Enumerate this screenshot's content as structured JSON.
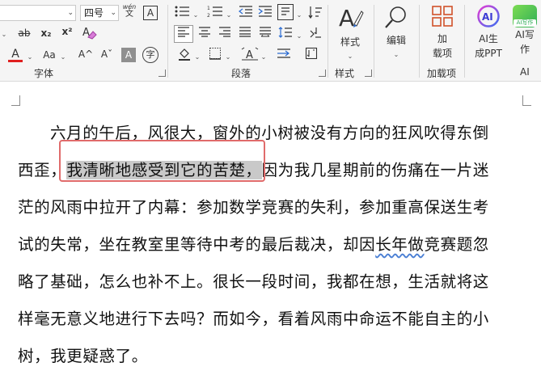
{
  "ribbon": {
    "font": {
      "size_value": "四号",
      "phonetic_top": "wén",
      "phonetic_bottom": "文",
      "box_char": "A",
      "strike": "ab",
      "sub": "x₂",
      "sup": "x²",
      "font_color_letter": "A",
      "change_case": "Aa",
      "grow": "A^",
      "shrink": "Aˇ",
      "shade_letter": "A",
      "enclose": "字",
      "group_label": "字体"
    },
    "paragraph": {
      "group_label": "段落"
    },
    "styles": {
      "label": "样式",
      "group_label": "样式"
    },
    "edit": {
      "label": "编辑"
    },
    "addins": {
      "label_line1": "加",
      "label_line2": "载项",
      "group_label": "加载项"
    },
    "ai": {
      "ai_gen_line1": "AI生",
      "ai_gen_line2": "成PPT",
      "ai_write_badge": "AI写作",
      "ai_write_line1": "AI写",
      "ai_write_line2": "作",
      "group_label": "AI"
    }
  },
  "colors": {
    "font_color_bar": "#e02020",
    "selection_box": "#e06b6b",
    "highlight": "#c9c9c9"
  },
  "document": {
    "line1": "六月的午后，风很大，窗外的小树被没有方向的狂风吹得东倒",
    "line2_pre": "西歪，",
    "line2_sel": "我清晰地感受到它的苦楚，",
    "line2_post": "因为我几星期前的伤痛在一片迷",
    "line3": "茫的风雨中拉开了内幕：参加数学竞赛的失利，参加重高保送生考",
    "line4_pre": "试的失常，坐在教室里等待中考的最后裁决，却因",
    "line4_squig": "长年做",
    "line4_post": "竞赛题忽",
    "line5": "略了基础，怎么也补不上。很长一段时间，我都在想，生活就将这",
    "line6": "样毫无意义地进行下去吗？而如今，看着风雨中命运不能自主的小",
    "line7": "树，我更疑惑了。"
  }
}
